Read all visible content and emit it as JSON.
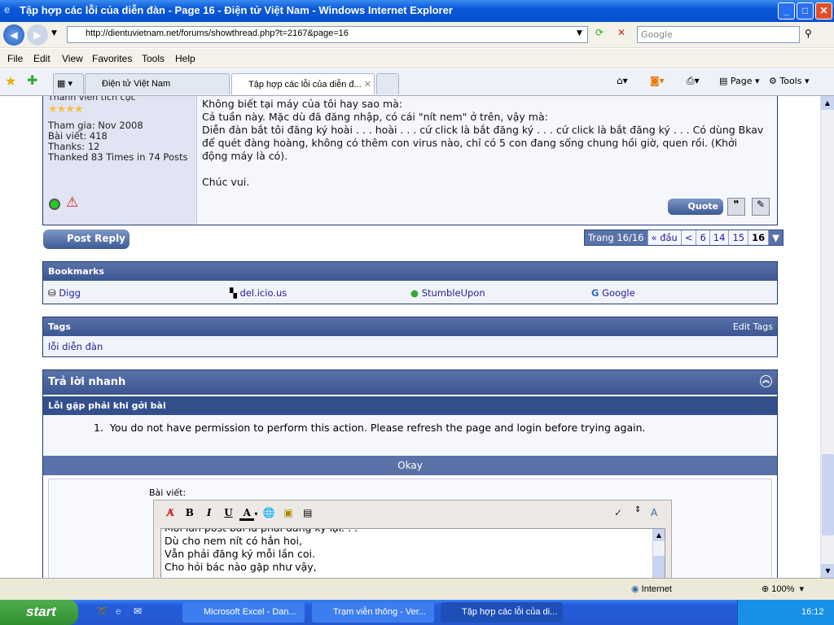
{
  "window": {
    "title": "Tập hợp các lỗi của diễn đàn - Page 16 - Điện tử Việt Nam - Windows Internet Explorer",
    "min": "_",
    "max": "□",
    "close": "✕"
  },
  "nav": {
    "url": "http://dientuvietnam.net/forums/showthread.php?t=2167&page=16",
    "search_placeholder": "Google",
    "back": "◀",
    "forward": "▶"
  },
  "menu": [
    "File",
    "Edit",
    "View",
    "Favorites",
    "Tools",
    "Help"
  ],
  "tabs": [
    {
      "label": "Điện tử Việt Nam"
    },
    {
      "label": "Tập hợp các lỗi của diễn đ...",
      "close": "✕"
    }
  ],
  "commandbar": {
    "page": "Page",
    "tools": "Tools"
  },
  "post": {
    "user_title": "Thành viên tích cực",
    "stars": "★★★★",
    "stats": [
      "Tham gia: Nov 2008",
      "Bài viết: 418",
      "Thanks: 12",
      "Thanked 83 Times in 74 Posts"
    ],
    "body": [
      "Không biết tại máy của tôi hay sao mà:",
      "Cả tuần này. Mặc dù đã đăng nhập, có cái \"nít nem\" ở trên, vậy mà:",
      "Diễn đàn bắt tôi đăng ký hoài . . . hoài . . . cứ click là bắt đăng ký . . . cứ click là bắt đăng ký . . . Có dùng Bkav để quét đàng hoàng, không có thêm con virus nào, chỉ có 5 con đang sống chung hồi giờ, quen rồi. (Khởi động máy là có).",
      "",
      "Chúc vui."
    ],
    "quote_label": "Quote"
  },
  "post_reply": "Post Reply",
  "pagination": {
    "label": "Trang 16/16",
    "first": "« đầu",
    "prev": "<",
    "pages": [
      "6",
      "14",
      "15"
    ],
    "current": "16"
  },
  "bookmarks": {
    "title": "Bookmarks",
    "items": [
      "Digg",
      "del.icio.us",
      "StumbleUpon",
      "Google"
    ]
  },
  "tags": {
    "title": "Tags",
    "edit": "Edit Tags",
    "items": [
      "lỗi diễn đàn"
    ]
  },
  "quick_reply": {
    "title": "Trả lời nhanh",
    "error_title": "Lỗi gặp phải khi gởi bài",
    "errors": [
      "You do not have permission to perform this action. Please refresh the page and login before trying again."
    ],
    "okay": "Okay",
    "message_label": "Bài viết:",
    "editor_lines": [
      "Mỗi lần post bài là phải đăng ký lại. . .",
      "Dù cho nem nít có hẳn hoi,",
      "Vẫn phải đăng ký mỗi lần coi.",
      "Cho hỏi bác nào gặp như vậy,"
    ]
  },
  "status": {
    "zone": "Internet",
    "zoom": "100%"
  },
  "taskbar": {
    "start": "start",
    "tasks": [
      "Microsoft Excel - Dan...",
      "Trạm viễn thông - Ver...",
      "Tập hợp các lỗi của di..."
    ],
    "clock": "16:12"
  }
}
